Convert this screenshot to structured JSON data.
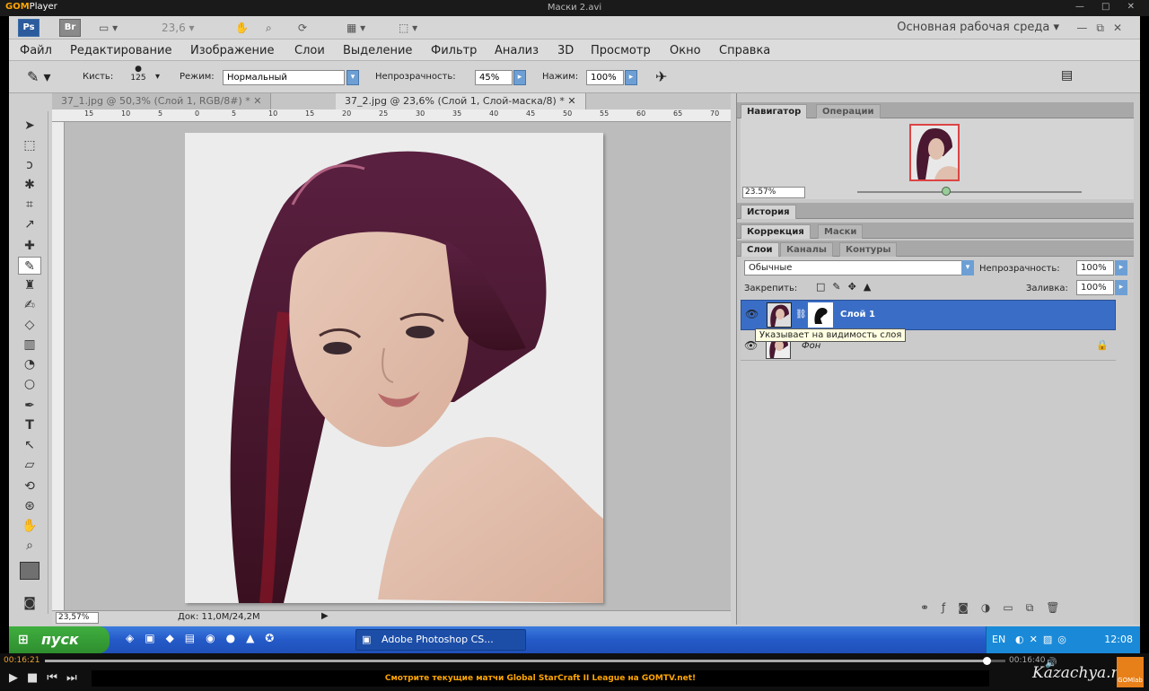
{
  "player": {
    "logo_a": "GOM",
    "logo_b": "Player",
    "file_title": "Маски 2.avi",
    "window_buttons": "— □ ✕",
    "time_elapsed": "00:16:21",
    "time_total": "00:16:40",
    "progress": 0.98,
    "ticker": "Смотрите текущие матчи Global StarCraft II League на GOMTV.net!",
    "watermark": "Kazachya.net",
    "corner_label": "GOMlab"
  },
  "photoshop": {
    "app_ps": "Ps",
    "app_br": "Br",
    "zoom_combo": "23,6",
    "workspace": "Основная рабочая среда",
    "menu": [
      "Файл",
      "Редактирование",
      "Изображение",
      "Слои",
      "Выделение",
      "Фильтр",
      "Анализ",
      "3D",
      "Просмотр",
      "Окно",
      "Справка"
    ],
    "options": {
      "brush_label": "Кисть:",
      "brush_size": "125",
      "mode_label": "Режим:",
      "mode_value": "Нормальный",
      "opacity_label": "Непрозрачность:",
      "opacity_value": "45%",
      "flow_label": "Нажим:",
      "flow_value": "100%"
    },
    "doc_tabs": [
      "37_1.jpg @ 50,3% (Слой 1, RGB/8#) *",
      "37_2.jpg @ 23,6% (Слой 1, Слой-маска/8) *"
    ],
    "ruler_h_labels": [
      "15",
      "10",
      "5",
      "0",
      "5",
      "10",
      "15",
      "20",
      "25",
      "30",
      "35",
      "40",
      "45",
      "50",
      "55",
      "60",
      "65",
      "70"
    ],
    "status_zoom": "23,57%",
    "status_doc": "Док: 11,0M/24,2M",
    "navigator": {
      "tabs": [
        "Навигатор",
        "Операции"
      ],
      "zoom": "23.57%"
    },
    "history_tab": "История",
    "adjust_tabs": [
      "Коррекция",
      "Маски"
    ],
    "layers": {
      "tabs": [
        "Слои",
        "Каналы",
        "Контуры"
      ],
      "blend": "Обычные",
      "opacity_label": "Непрозрачность:",
      "opacity": "100%",
      "lock_label": "Закрепить:",
      "fill_label": "Заливка:",
      "fill": "100%",
      "items": [
        {
          "name": "Слой 1",
          "selected": true
        },
        {
          "name": "Фон",
          "selected": false
        }
      ],
      "tooltip": "Указывает на видимость слоя"
    }
  },
  "taskbar": {
    "start": "пуск",
    "task": "Adobe Photoshop CS...",
    "lang": "EN",
    "clock": "12:08"
  }
}
